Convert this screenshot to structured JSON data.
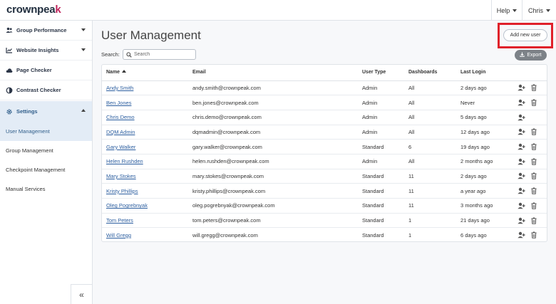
{
  "app": {
    "logo_main": "crownpeak",
    "logo_mark": "k"
  },
  "topnav": {
    "help": "Help",
    "user": "Chris"
  },
  "sidebar": {
    "items": [
      {
        "label": "Group Performance",
        "icon": "users-icon"
      },
      {
        "label": "Website Insights",
        "icon": "chart-icon"
      },
      {
        "label": "Page Checker",
        "icon": "cloud-icon"
      },
      {
        "label": "Contrast Checker",
        "icon": "contrast-icon"
      },
      {
        "label": "Settings",
        "icon": "gear-icon"
      }
    ],
    "sub_items": [
      {
        "label": "User Management"
      },
      {
        "label": "Group Management"
      },
      {
        "label": "Checkpoint Management"
      },
      {
        "label": "Manual Services"
      }
    ],
    "collapse": "«"
  },
  "main": {
    "title": "User Management",
    "add_button": "Add new user",
    "export_button": "Export",
    "search_label": "Search:",
    "search_placeholder": "Search",
    "columns": [
      "Name",
      "Email",
      "User Type",
      "Dashboards",
      "Last Login"
    ],
    "rows": [
      {
        "name": "Andy Smith",
        "email": "andy.smith@crownpeak.com",
        "type": "Admin",
        "dashboards": "All",
        "last_login": "2 days ago",
        "delete": true
      },
      {
        "name": "Ben Jones",
        "email": "ben.jones@crownpeak.com",
        "type": "Admin",
        "dashboards": "All",
        "last_login": "Never",
        "delete": true
      },
      {
        "name": "Chris Demo",
        "email": "chris.demo@crownpeak.com",
        "type": "Admin",
        "dashboards": "All",
        "last_login": "5 days ago",
        "delete": false
      },
      {
        "name": "DQM Admin",
        "email": "dqmadmin@crownpeak.com",
        "type": "Admin",
        "dashboards": "All",
        "last_login": "12 days ago",
        "delete": true
      },
      {
        "name": "Gary Walker",
        "email": "gary.walker@crownpeak.com",
        "type": "Standard",
        "dashboards": "6",
        "last_login": "19 days ago",
        "delete": true
      },
      {
        "name": "Helen Rushden",
        "email": "helen.rushden@crownpeak.com",
        "type": "Admin",
        "dashboards": "All",
        "last_login": "2 months ago",
        "delete": true
      },
      {
        "name": "Mary Stokes",
        "email": "mary.stokes@crownpeak.com",
        "type": "Standard",
        "dashboards": "11",
        "last_login": "2 days ago",
        "delete": true
      },
      {
        "name": "Kristy Phillips",
        "email": "kristy.phillips@crownpeak.com",
        "type": "Standard",
        "dashboards": "11",
        "last_login": "a year ago",
        "delete": true
      },
      {
        "name": "Oleg Pogrebnyak",
        "email": "oleg.pogrebnyak@crownpeak.com",
        "type": "Standard",
        "dashboards": "11",
        "last_login": "3 months ago",
        "delete": true
      },
      {
        "name": "Tom Peters",
        "email": "tom.peters@crownpeak.com",
        "type": "Standard",
        "dashboards": "1",
        "last_login": "21 days ago",
        "delete": true
      },
      {
        "name": "Will Gregg",
        "email": "will.gregg@crownpeak.com",
        "type": "Standard",
        "dashboards": "1",
        "last_login": "6 days ago",
        "delete": true
      }
    ]
  },
  "colors": {
    "accent": "#2d5fa0",
    "highlight": "#e0202a",
    "brand": "#c0245c"
  }
}
